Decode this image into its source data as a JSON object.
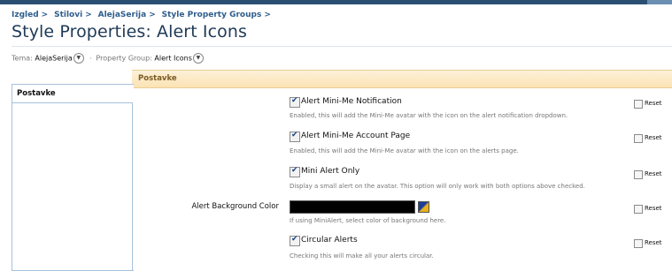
{
  "breadcrumb": [
    "Izgled",
    "Stilovi",
    "AlejaSerija",
    "Style Property Groups"
  ],
  "page_title": "Style Properties: Alert Icons",
  "filters": {
    "theme_label": "Tema:",
    "theme_value": "AlejaSerija",
    "group_label": "Property Group:",
    "group_value": "Alert Icons"
  },
  "sidebar": {
    "tab_label": "Postavke"
  },
  "section": {
    "header": "Postavke"
  },
  "reset_label": "Reset",
  "options": [
    {
      "type": "checkbox",
      "checked": true,
      "label": "Alert Mini-Me Notification",
      "hint": "Enabled, this will add the Mini-Me avatar with the icon on the alert notification dropdown."
    },
    {
      "type": "checkbox",
      "checked": true,
      "label": "Alert Mini-Me Account Page",
      "hint": "Enabled, this will add the Mini-Me avatar with the icon on the alerts page."
    },
    {
      "type": "checkbox",
      "checked": true,
      "label": "Mini Alert Only",
      "hint": "Display a small alert on the avatar. This option will only work with both options above checked."
    },
    {
      "type": "color",
      "row_label": "Alert Background Color",
      "value_color": "#000000",
      "hint": "If using MiniAlert, select color of background here."
    },
    {
      "type": "checkbox",
      "checked": true,
      "label": "Circular Alerts",
      "hint": "Checking this will make all your alerts circular."
    }
  ]
}
